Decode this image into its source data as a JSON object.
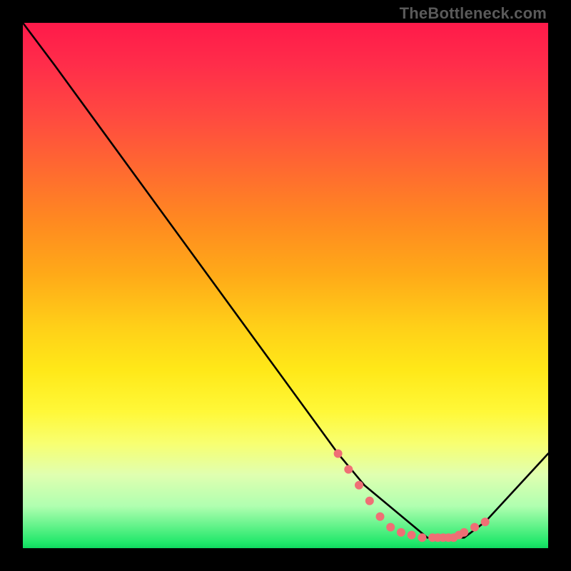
{
  "watermark": "TheBottleneck.com",
  "chart_data": {
    "type": "line",
    "title": "",
    "xlabel": "",
    "ylabel": "",
    "x_range": [
      0,
      100
    ],
    "y_range": [
      0,
      100
    ],
    "series": [
      {
        "name": "curve",
        "color": "#000000",
        "x": [
          0,
          6,
          60,
          65,
          77,
          84,
          88,
          100
        ],
        "y": [
          100,
          92,
          18,
          12,
          2,
          2,
          5,
          18
        ]
      }
    ],
    "markers": {
      "name": "highlight-dots",
      "color": "#ef6f75",
      "radius": 6,
      "x": [
        60,
        62,
        64,
        66,
        68,
        70,
        72,
        74,
        76,
        78,
        79,
        80,
        81,
        82,
        83,
        84,
        86,
        88
      ],
      "y": [
        18,
        15,
        12,
        9,
        6,
        4,
        3,
        2.5,
        2,
        2,
        2,
        2,
        2,
        2,
        2.5,
        3,
        4,
        5
      ]
    }
  }
}
